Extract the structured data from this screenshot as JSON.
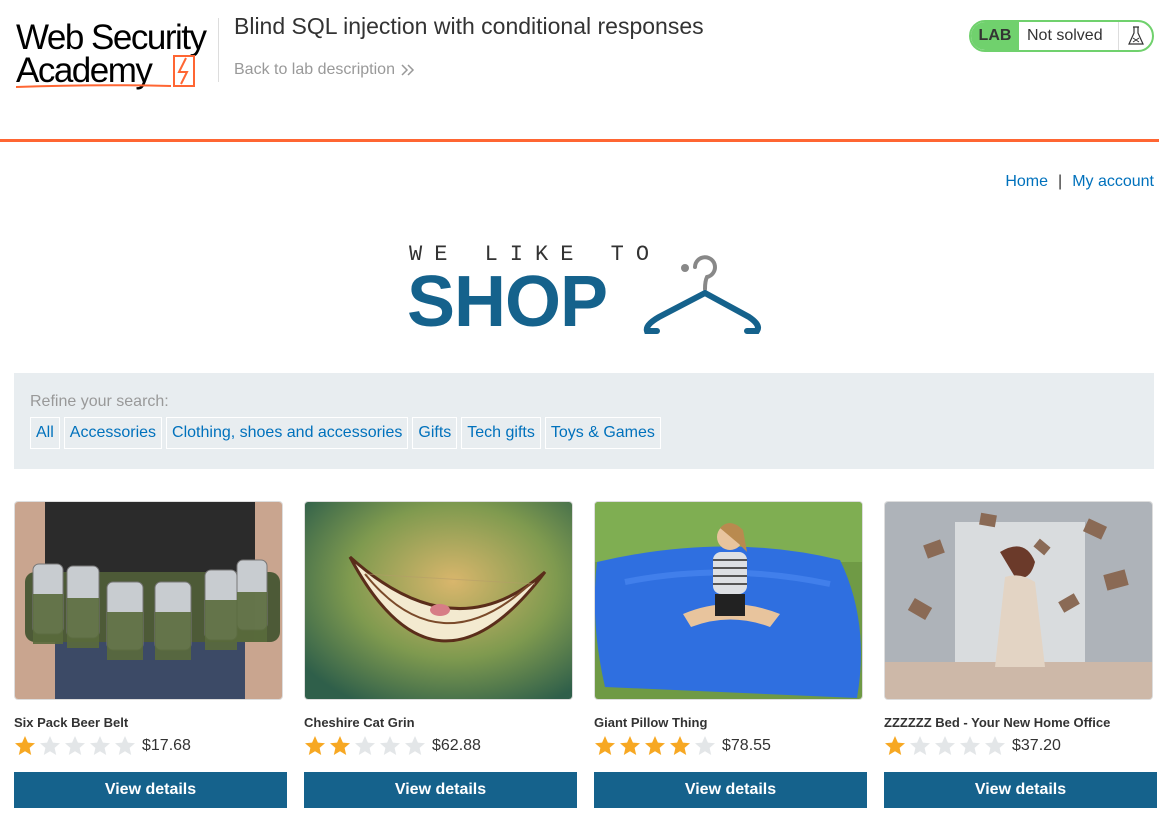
{
  "academy": {
    "logo_line1": "Web Security",
    "logo_line2": "Academy",
    "lab_title": "Blind SQL injection with conditional responses",
    "back_link": "Back to lab description",
    "lab_badge": "LAB",
    "lab_status": "Not solved",
    "accent_color": "#ff6633",
    "status_color": "#70d16d"
  },
  "nav": {
    "home": "Home",
    "separator": "|",
    "my_account": "My account"
  },
  "banner": {
    "tagline": "WE LIKE TO",
    "word": "SHOP",
    "color": "#15628c"
  },
  "filter": {
    "label": "Refine your search:",
    "categories": [
      "All",
      "Accessories",
      "Clothing, shoes and accessories",
      "Gifts",
      "Tech gifts",
      "Toys & Games"
    ]
  },
  "products": [
    {
      "name": "Six Pack Beer Belt",
      "rating": 1,
      "max_rating": 5,
      "price": "$17.68",
      "button": "View details",
      "image": "beer-belt-photo"
    },
    {
      "name": "Cheshire Cat Grin",
      "rating": 2,
      "max_rating": 5,
      "price": "$62.88",
      "button": "View details",
      "image": "cat-grin-illustration"
    },
    {
      "name": "Giant Pillow Thing",
      "rating": 4,
      "max_rating": 5,
      "price": "$78.55",
      "button": "View details",
      "image": "giant-pillow-photo"
    },
    {
      "name": "ZZZZZZ Bed - Your New Home Office",
      "rating": 1,
      "max_rating": 5,
      "price": "$37.20",
      "button": "View details",
      "image": "bed-office-photo"
    }
  ]
}
